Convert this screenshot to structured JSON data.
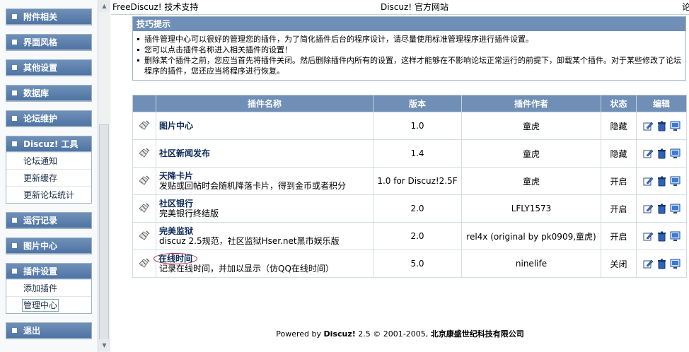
{
  "sidebar": {
    "blocks": [
      {
        "label": "附件相关",
        "items": []
      },
      {
        "label": "界面风格",
        "items": []
      },
      {
        "label": "其他设置",
        "items": []
      },
      {
        "label": "数据库",
        "items": []
      },
      {
        "label": "论坛维护",
        "items": []
      },
      {
        "label": "Discuz! 工具",
        "items": [
          "论坛通知",
          "更新缓存",
          "更新论坛统计"
        ]
      },
      {
        "label": "运行记录",
        "items": []
      },
      {
        "label": "图片中心",
        "items": []
      },
      {
        "label": "插件设置",
        "items": [
          "添加插件",
          "管理中心"
        ]
      },
      {
        "label": "退出",
        "items": []
      }
    ]
  },
  "topbar": {
    "left_link": "FreeDiscuz! 技术支持",
    "center_link": "Discuz! 官方网站",
    "right_partial": "论"
  },
  "tips": {
    "title": "技巧提示",
    "lines": [
      "插件管理中心可以很好的管理您的插件，为了简化插件后台的程序设计，请尽量使用标准管理程序进行插件设置。",
      "您可以点击插件名称进入相关插件的设置！",
      "删除某个插件之前，您应当首先将插件关闭。然后删除插件内所有的设置，这样才能够在不影响论坛正常运行的前提下，卸载某个插件。对于某些修改了论坛程序的插件，您还应当将程序进行恢复。"
    ]
  },
  "table": {
    "headers": {
      "name": "插件名称",
      "version": "版本",
      "author": "插件作者",
      "status": "状态",
      "edit": "编辑"
    },
    "rows": [
      {
        "name": "图片中心",
        "desc": "",
        "version": "1.0",
        "author": "童虎",
        "status": "隐藏"
      },
      {
        "name": "社区新闻发布",
        "desc": "",
        "version": "1.4",
        "author": "童虎",
        "status": "隐藏"
      },
      {
        "name": "天降卡片",
        "desc": "发贴或回帖时会随机降落卡片，得到金币或者积分",
        "version": "1.0 for Discuz!2.5F",
        "author": "童虎",
        "status": "开启"
      },
      {
        "name": "社区银行",
        "desc": "完美银行终结版",
        "version": "2.0",
        "author": "LFLY1573",
        "status": "开启"
      },
      {
        "name": "完美监狱",
        "desc": "discuz 2.5规范，社区监狱Hser.net黑市娱乐版",
        "version": "2.0",
        "author": "rel4x (original by pk0909,童虎)",
        "status": "开启"
      },
      {
        "name": "在线时间",
        "desc": "记录在线时间，并加以显示（仿QQ在线时间）",
        "version": "5.0",
        "author": "ninelife",
        "status": "关闭"
      }
    ]
  },
  "footer": {
    "powered": "Powered by",
    "brand": "Discuz!",
    "version": "2.5",
    "copyright": "© 2001-2005,",
    "company": "北京康盛世纪科技有限公司"
  },
  "colors": {
    "header_blue": "#6f8fb6",
    "menu_blue": "#4f74a4",
    "circle_red": "#b0204a"
  }
}
